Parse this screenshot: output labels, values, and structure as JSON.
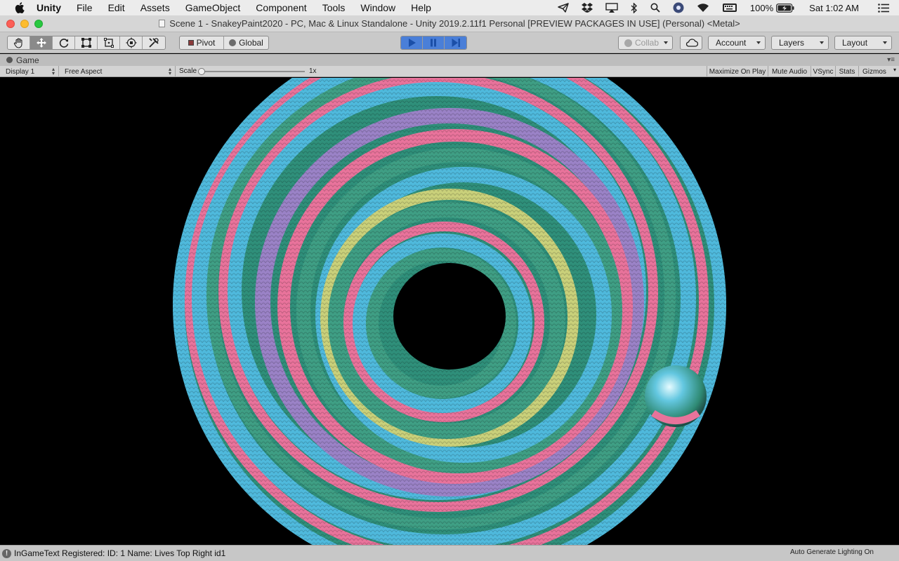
{
  "menubar": {
    "app_name": "Unity",
    "items": [
      "File",
      "Edit",
      "Assets",
      "GameObject",
      "Component",
      "Tools",
      "Window",
      "Help"
    ],
    "battery": "100%",
    "clock": "Sat 1:02 AM"
  },
  "window": {
    "title": "Scene 1 - SnakeyPaint2020 - PC, Mac & Linux Standalone - Unity 2019.2.11f1 Personal [PREVIEW PACKAGES IN USE] (Personal) <Metal>"
  },
  "toolbar": {
    "pivot_label": "Pivot",
    "global_label": "Global",
    "collab_label": "Collab",
    "account_label": "Account",
    "layers_label": "Layers",
    "layout_label": "Layout"
  },
  "game_view": {
    "tab_label": "Game",
    "display": "Display 1",
    "aspect": "Free Aspect",
    "scale_label": "Scale",
    "scale_value": "1x",
    "buttons": {
      "maximize": "Maximize On Play",
      "mute": "Mute Audio",
      "vsync": "VSync",
      "stats": "Stats",
      "gizmos": "Gizmos"
    }
  },
  "status": {
    "message": "InGameText Registered: ID: 1 Name: Lives Top Right id1",
    "lighting": "Auto Generate Lighting On"
  },
  "colors": {
    "play_active": "#4a7fd8",
    "stripe_pink": "#e8739b",
    "stripe_cyan": "#4fb9dc",
    "stripe_green": "#3f9e84",
    "stripe_lilac": "#9a82c6",
    "stripe_yellow": "#c9d07a"
  }
}
